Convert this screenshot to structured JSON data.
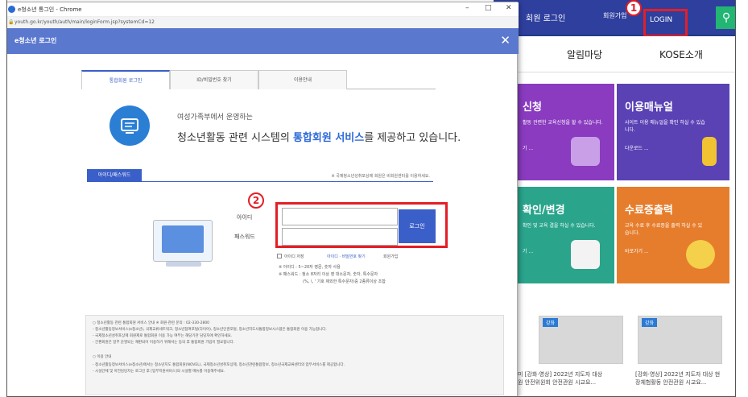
{
  "site": {
    "header_links": {
      "member_login": "회원 로그인",
      "login": "LOGIN",
      "signup": "회원가입"
    },
    "search_icon": "search-icon",
    "nav": {
      "notice_board": "알림마당",
      "about": "KOSE소개"
    },
    "tiles": [
      {
        "title": "신청",
        "text": "활동 관련한 교육신청을 할 수 있습니다.",
        "more": "기 ...",
        "color": "#8a3bbf"
      },
      {
        "title": "이용매뉴얼",
        "text": "사이트 이용 매뉴얼을 확인 하실 수 있습니다.",
        "more": "다운로드 ...",
        "color": "#5a42b5"
      },
      {
        "title": "확인/변경",
        "text": "확인 및 교육 결을 하실 수 있습니다.",
        "more": "기 ...",
        "color": "#2aa58c"
      },
      {
        "title": "수료증출력",
        "text": "교육 수료 후 수료증을 출력 하실 수 있습니다.",
        "more": "바로가기 ...",
        "color": "#e67d2c"
      }
    ],
    "thumbs": [
      {
        "tag": "강좌",
        "caption": "미 [강화·영상] 2022년 지도자 대상 원 안전위원회 안전관원 시교요..."
      },
      {
        "tag": "강좌",
        "caption": "[강화·영상] 2022년 지도자 대상 현장체험활동 안전관원 시교요..."
      }
    ]
  },
  "badges": {
    "one": "1",
    "two": "2"
  },
  "popup": {
    "window_title": "e청소년 통그인 - Chrome",
    "url": "youth.go.kr/youth/auth/main/loginForm.jsp?systemCd=12",
    "minimize": "–",
    "maximize": "□",
    "close": "✕",
    "header_title": "e청소년 로그인",
    "tabs": [
      "통합회원 로그인",
      "ID/비밀번호 찾기",
      "이용안내"
    ],
    "intro_small": "여성가족부에서 운영하는",
    "intro_prefix": "청소년활동 관련 시스템의 ",
    "intro_highlight": "통합회원 서비스",
    "intro_suffix": "를 제공하고 있습니다.",
    "section_tab": "아이디/패스워드",
    "section_note": "※ 국제청소년성취포상제 회원은 비회원센터를 이용하세요.",
    "id_label": "아이디",
    "pw_label": "패스워드",
    "id_placeholder": "",
    "pw_placeholder": "",
    "login_button": "로그인",
    "save_id": "아이디 저장",
    "find_link": "아이디 · 비밀번호 찾기",
    "join_link": "회원가입",
    "hint1": "※ 아이디 : 5~20자 영문, 숫자 사용",
    "hint2": "※ 패스워드 : 청소 8자리 이상 영 대소문자, 숫자, 특수문자",
    "hint3": "(%, \\, ' 기호 제외한 특수문자)중 2종류이상 조합",
    "notice_lines": [
      "○ 청소년활동 관련 통합회원 서비스 안내 ※ 회원·관련 문의 : 02-330-2800",
      "- 청소년활동정보서비스(e청소년), 국제교류네트워크, 청소년참여포털(다이어), 청소년인권포털, 청소년지도사통합정보시스템은 통합회원 이용 가능합니다.",
      "- 국제청소년성취포상제 회원제로 통합회원 이용 가능 여부는 해당기관 담당자에 확인하세요.",
      "- 간편회원은 일부 운영되는 재판되어 이용하기 위해서는 동의 후 통합회원 가입이 필요합니다.",
      "○ 이용 안내",
      "- 청소년활동정보서비스(e청소년)에서는 청소년지도 통합회원(NOVEL), 국제청소년성취포상제, 청소년관련통합정보, 청소년국제교류센터의 업무서비스를 제공합니다.",
      "- 시설단체 및 아전담당자는 로그인 후 [업무지원서비스]의 시설별 메뉴를 이용해주세요."
    ]
  }
}
